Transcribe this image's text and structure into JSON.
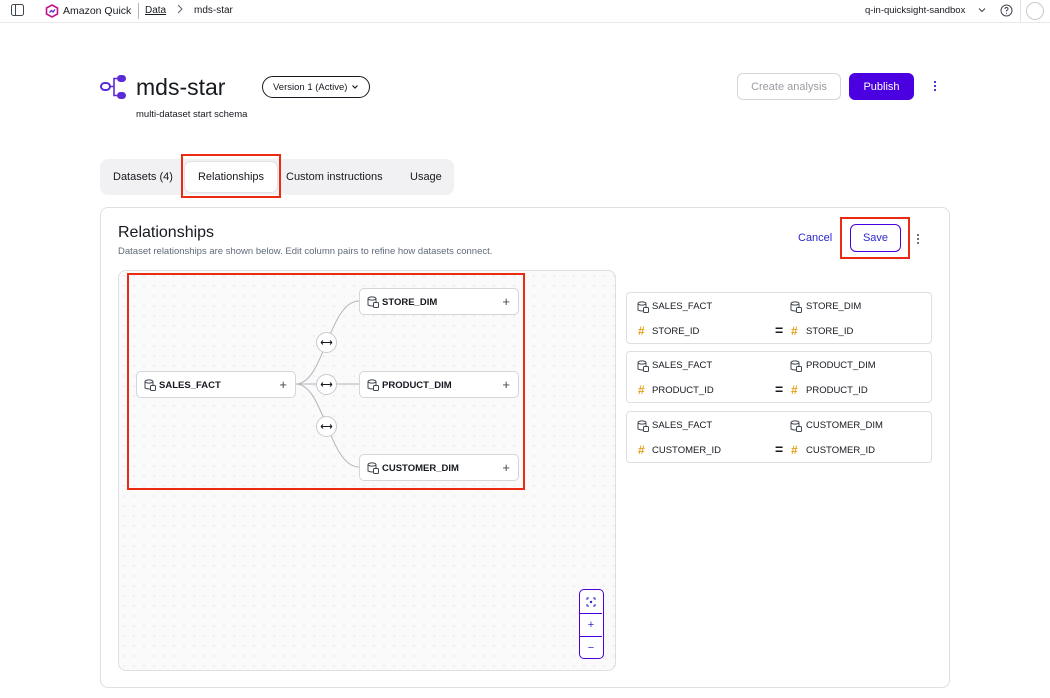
{
  "topbar": {
    "app_name": "Amazon Quick",
    "breadcrumb_data": "Data",
    "breadcrumb_current": "mds-star",
    "account": "q-in-quicksight-sandbox"
  },
  "header": {
    "title": "mds-star",
    "version_label": "Version 1 (Active)",
    "subtitle": "multi-dataset start schema",
    "create_analysis_label": "Create analysis",
    "publish_label": "Publish"
  },
  "tabs": {
    "datasets": "Datasets (4)",
    "relationships": "Relationships",
    "custom_instructions": "Custom instructions",
    "usage": "Usage"
  },
  "relationships": {
    "title": "Relationships",
    "description": "Dataset relationships are shown below. Edit column pairs to refine how datasets connect.",
    "cancel_label": "Cancel",
    "save_label": "Save"
  },
  "graph": {
    "root": "SALES_FACT",
    "nodes": [
      "STORE_DIM",
      "PRODUCT_DIM",
      "CUSTOMER_DIM"
    ]
  },
  "pairs": [
    {
      "left_dataset": "SALES_FACT",
      "right_dataset": "STORE_DIM",
      "left_column": "STORE_ID",
      "right_column": "STORE_ID",
      "operator": "="
    },
    {
      "left_dataset": "SALES_FACT",
      "right_dataset": "PRODUCT_DIM",
      "left_column": "PRODUCT_ID",
      "right_column": "PRODUCT_ID",
      "operator": "="
    },
    {
      "left_dataset": "SALES_FACT",
      "right_dataset": "CUSTOMER_DIM",
      "left_column": "CUSTOMER_ID",
      "right_column": "CUSTOMER_ID",
      "operator": "="
    }
  ],
  "colors": {
    "accent": "#4a00e0",
    "highlight": "#ea2a12",
    "column_hash": "#e6a117"
  }
}
